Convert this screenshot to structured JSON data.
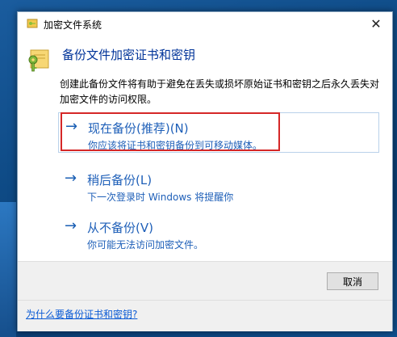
{
  "window": {
    "title": "加密文件系统",
    "close_glyph": "✕"
  },
  "header": {
    "title": "备份文件加密证书和密钥",
    "icon": "key-certificate-icon"
  },
  "description": "创建此备份文件将有助于避免在丢失或损坏原始证书和密钥之后永久丢失对加密文件的访问权限。",
  "options": [
    {
      "arrow": "→",
      "title": "现在备份(推荐)(N)",
      "subtitle": "你应该将证书和密钥备份到可移动媒体。"
    },
    {
      "arrow": "→",
      "title": "稍后备份(L)",
      "subtitle": "下一次登录时 Windows 将提醒你"
    },
    {
      "arrow": "→",
      "title": "从不备份(V)",
      "subtitle": "你可能无法访问加密文件。"
    }
  ],
  "footer": {
    "cancel_label": "取消",
    "help_link": "为什么要备份证书和密钥?"
  },
  "colors": {
    "link_blue": "#1e5fb8",
    "highlight_red": "#d52727",
    "title_blue": "#003399"
  }
}
